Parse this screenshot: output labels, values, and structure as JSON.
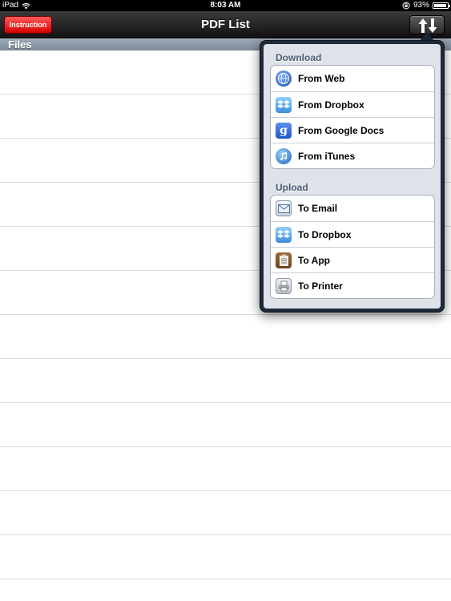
{
  "status_bar": {
    "device": "iPad",
    "time": "8:03 AM",
    "battery": "93%",
    "battery_level": 0.93
  },
  "nav_bar": {
    "title": "PDF List",
    "instruction_label": "Instruction",
    "transfer_icon": "up-down-arrows-icon"
  },
  "files_header": "Files",
  "popover": {
    "download": {
      "title": "Download",
      "items": [
        {
          "label": "From Web",
          "icon": "globe-icon"
        },
        {
          "label": "From Dropbox",
          "icon": "dropbox-icon"
        },
        {
          "label": "From Google Docs",
          "icon": "google-icon"
        },
        {
          "label": "From iTunes",
          "icon": "itunes-icon"
        }
      ]
    },
    "upload": {
      "title": "Upload",
      "items": [
        {
          "label": "To Email",
          "icon": "mail-icon"
        },
        {
          "label": "To Dropbox",
          "icon": "dropbox-icon"
        },
        {
          "label": "To App",
          "icon": "clipboard-icon"
        },
        {
          "label": "To Printer",
          "icon": "printer-icon"
        }
      ]
    }
  },
  "colors": {
    "nav_bar": "#1f1f1f",
    "instruction_button": "#e81a1a",
    "files_header": "#8a96a4",
    "popover_frame": "#1e2a38",
    "section_title": "#4d5d72"
  }
}
